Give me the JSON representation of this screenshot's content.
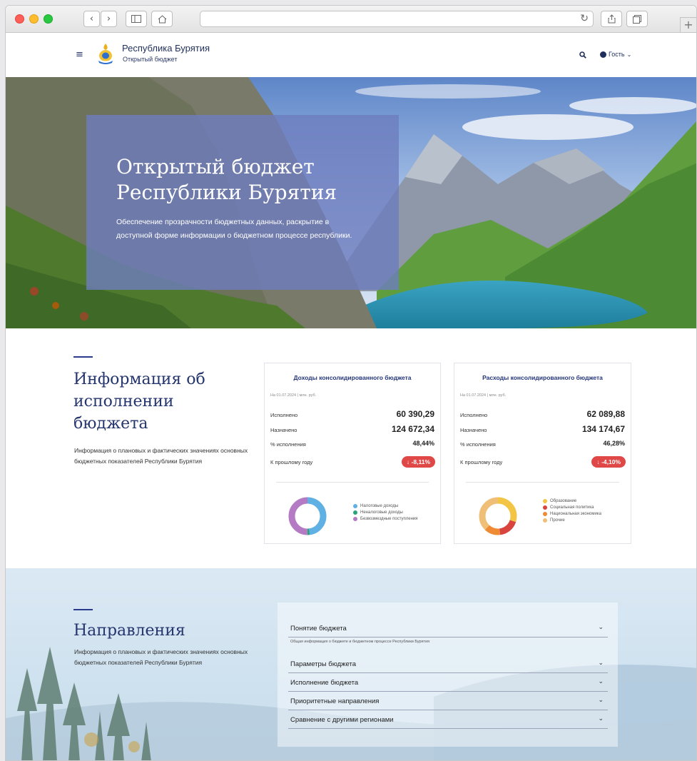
{
  "browser": {
    "address": "",
    "new_tab": "+"
  },
  "header": {
    "brand_title": "Республика Бурятия",
    "brand_subtitle": "Открытый бюджет",
    "user_label": "Гость"
  },
  "hero": {
    "title_line1": "Открытый бюджет",
    "title_line2": "Республики Бурятия",
    "description": "Обеспечение прозрачности бюджетных данных, раскрытие в доступной форме информации о бюджетном процессе республики."
  },
  "budget_info": {
    "title_line1": "Информация об",
    "title_line2": "исполнении",
    "title_line3": "бюджета",
    "description": "Информация о плановых и фактических значениях основных бюджетных показателей Республики Бурятия"
  },
  "cards": [
    {
      "title": "Доходы консолидированного бюджета",
      "date": "На 01.07.2024 | млн. руб.",
      "executed_label": "Исполнено",
      "executed_value": "60 390,29",
      "assigned_label": "Назначено",
      "assigned_value": "124 672,34",
      "pct_label": "% исполнения",
      "pct_value": "48,44%",
      "prev_label": "К прошлому году",
      "prev_value": "↓ -8,11%",
      "legend": [
        {
          "label": "Налоговые доходы",
          "color": "#5fb1e3"
        },
        {
          "label": "Неналоговые доходы",
          "color": "#2aa37a"
        },
        {
          "label": "Безвозмездные поступления",
          "color": "#b57ac4"
        }
      ],
      "donut": [
        {
          "value": 0.48,
          "color": "#5fb1e3"
        },
        {
          "value": 0.02,
          "color": "#2aa37a"
        },
        {
          "value": 0.5,
          "color": "#b57ac4"
        }
      ]
    },
    {
      "title": "Расходы консолидированного бюджета",
      "date": "На 01.07.2024 | млн. руб.",
      "executed_label": "Исполнено",
      "executed_value": "62 089,88",
      "assigned_label": "Назначено",
      "assigned_value": "134 174,67",
      "pct_label": "% исполнения",
      "pct_value": "46,28%",
      "prev_label": "К прошлому году",
      "prev_value": "↓ -4,10%",
      "legend": [
        {
          "label": "Образование",
          "color": "#f2c545"
        },
        {
          "label": "Социальная политика",
          "color": "#d9443e"
        },
        {
          "label": "Национальная экономика",
          "color": "#ef8a35"
        },
        {
          "label": "Прочие",
          "color": "#efbf78"
        }
      ],
      "donut": [
        {
          "value": 0.3,
          "color": "#f2c545"
        },
        {
          "value": 0.18,
          "color": "#d9443e"
        },
        {
          "value": 0.14,
          "color": "#ef8a35"
        },
        {
          "value": 0.38,
          "color": "#efbf78"
        }
      ]
    }
  ],
  "directions": {
    "title": "Направления",
    "description": "Информация о плановых и фактических значениях основных бюджетных показателей Республики Бурятия",
    "items": [
      {
        "label": "Понятие бюджета",
        "description": "Общая информация о бюджете и бюджетном процессе Республики Бурятия"
      },
      {
        "label": "Параметры бюджета"
      },
      {
        "label": "Исполнение бюджета"
      },
      {
        "label": "Приоритетные направления"
      },
      {
        "label": "Сравнение с другими регионами"
      }
    ]
  }
}
